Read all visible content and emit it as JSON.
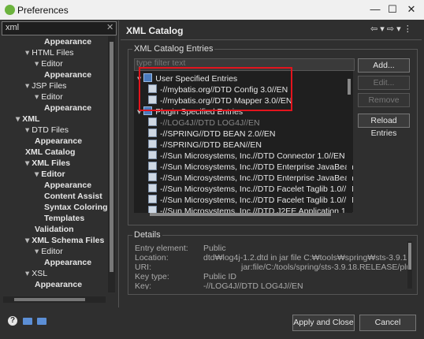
{
  "window": {
    "title": "Preferences"
  },
  "window_controls": {
    "minimize": "—",
    "maximize": "☐",
    "close": "✕"
  },
  "filter": {
    "value": "xml",
    "clear": "✕"
  },
  "tree": {
    "items": [
      {
        "label": "Appearance",
        "bold": true
      },
      {
        "label": "HTML Files",
        "arrow": "▾"
      },
      {
        "label": "Editor",
        "arrow": "▾"
      },
      {
        "label": "Appearance",
        "bold": true
      },
      {
        "label": "JSP Files",
        "arrow": "▾"
      },
      {
        "label": "Editor",
        "arrow": "▾"
      },
      {
        "label": "Appearance",
        "bold": true
      },
      {
        "label": "XML",
        "bold": true,
        "arrow": "▾"
      },
      {
        "label": "DTD Files",
        "arrow": "▾"
      },
      {
        "label": "Appearance",
        "bold": true
      },
      {
        "label": "XML Catalog",
        "bold": true
      },
      {
        "label": "XML Files",
        "bold": true,
        "arrow": "▾"
      },
      {
        "label": "Editor",
        "bold": true,
        "arrow": "▾"
      },
      {
        "label": "Appearance",
        "bold": true
      },
      {
        "label": "Content Assist",
        "bold": true
      },
      {
        "label": "Syntax Coloring",
        "bold": true
      },
      {
        "label": "Templates",
        "bold": true
      },
      {
        "label": "Validation",
        "bold": true
      },
      {
        "label": "XML Schema Files",
        "bold": true,
        "arrow": "▾"
      },
      {
        "label": "Editor",
        "arrow": "▾"
      },
      {
        "label": "Appearance",
        "bold": true
      },
      {
        "label": "XSL",
        "arrow": "▾"
      },
      {
        "label": "Appearance",
        "bold": true
      }
    ]
  },
  "page": {
    "title": "XML Catalog",
    "nav_icons": "⇦ ▾ ⇨ ▾ ⋮"
  },
  "entries": {
    "group_label": "XML Catalog Entries",
    "filter_placeholder": "type filter text",
    "rows": [
      {
        "label": "User Specified Entries",
        "kind": "folder",
        "arrow": "▾"
      },
      {
        "label": "-//mybatis.org//DTD Config 3.0//EN",
        "kind": "file"
      },
      {
        "label": "-//mybatis.org//DTD Mapper 3.0//EN",
        "kind": "file"
      },
      {
        "label": "Plugin Specified Entries",
        "kind": "folder",
        "arrow": "▾"
      },
      {
        "label": "-//LOG4J//DTD LOG4J//EN",
        "kind": "file",
        "dim": true
      },
      {
        "label": "-//SPRING//DTD BEAN 2.0//EN",
        "kind": "file"
      },
      {
        "label": "-//SPRING//DTD BEAN//EN",
        "kind": "file"
      },
      {
        "label": "-//Sun Microsystems, Inc.//DTD Connector 1.0//EN",
        "kind": "file"
      },
      {
        "label": "-//Sun Microsystems, Inc.//DTD Enterprise JavaBeans 1.",
        "kind": "file"
      },
      {
        "label": "-//Sun Microsystems, Inc.//DTD Enterprise JavaBeans 2.",
        "kind": "file"
      },
      {
        "label": "-//Sun Microsystems, Inc.//DTD Facelet Taglib 1.0//EN",
        "kind": "file"
      },
      {
        "label": "-//Sun Microsystems, Inc.//DTD Facelet Taglib 1.0//EN",
        "kind": "file"
      },
      {
        "label": "-//Sun Microsystems, Inc.//DTD J2EE Application 1.2//E",
        "kind": "file"
      }
    ],
    "buttons": {
      "add": "Add...",
      "edit": "Edit...",
      "remove": "Remove",
      "reload": "Reload Entries"
    }
  },
  "details": {
    "group_label": "Details",
    "rows": [
      {
        "label": "Entry element:",
        "value": "Public"
      },
      {
        "label": "Location:",
        "value": "dtd₩log4j-1.2.dtd in jar file C:₩tools₩spring₩sts-3.9.18.RELEASE"
      },
      {
        "label": "URI:",
        "value": "jar:file/C:/tools/spring/sts-3.9.18.RELEASE/plugins/org.sp"
      },
      {
        "label": "Key type:",
        "value": "Public ID"
      },
      {
        "label": "Key:",
        "value": "-//LOG4J//DTD LOG4J//EN"
      }
    ]
  },
  "footer": {
    "help": "?",
    "apply_close": "Apply and Close",
    "cancel": "Cancel"
  },
  "colors": {
    "highlight_box": "#e3141d",
    "background": "#2f2f2f"
  }
}
